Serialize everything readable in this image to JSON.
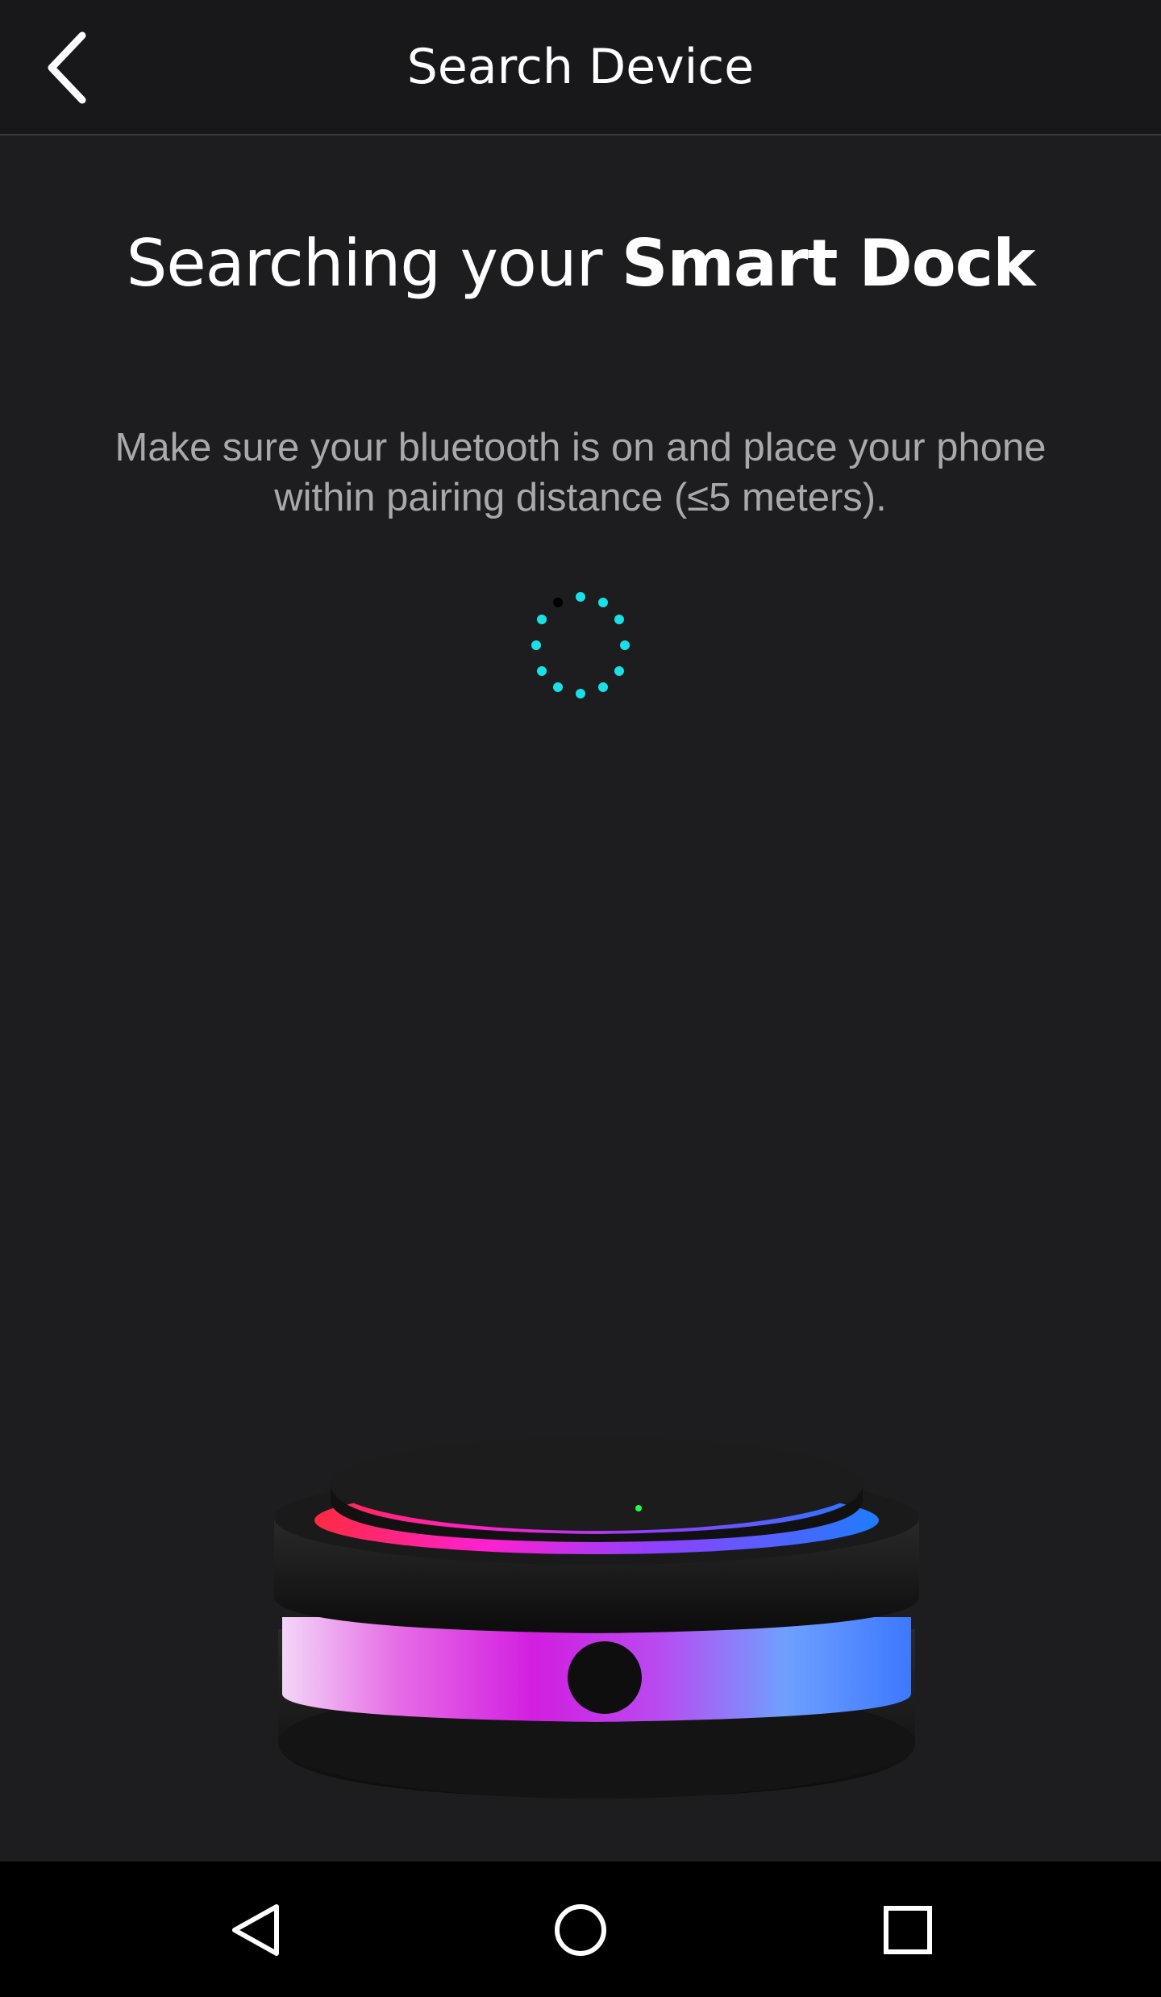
{
  "app_bar": {
    "title": "Search Device",
    "back_icon": "chevron-left-icon"
  },
  "main": {
    "heading_prefix": "Searching your ",
    "heading_emphasis": "Smart Dock",
    "instructions_line1": "Make sure your bluetooth is on and place your phone",
    "instructions_line2": "within pairing distance (≤5 meters).",
    "spinner_icon": "loading-spinner-icon",
    "device_image": "smart-dock-image"
  },
  "nav_bar": {
    "back_icon": "nav-back-triangle-icon",
    "home_icon": "nav-home-circle-icon",
    "recents_icon": "nav-recents-square-icon"
  },
  "colors": {
    "background": "#1d1d1f",
    "app_bar": "#18181a",
    "accent": "#19e0e6",
    "secondary_text": "#a9a9ab",
    "nav_bar": "#000000"
  }
}
